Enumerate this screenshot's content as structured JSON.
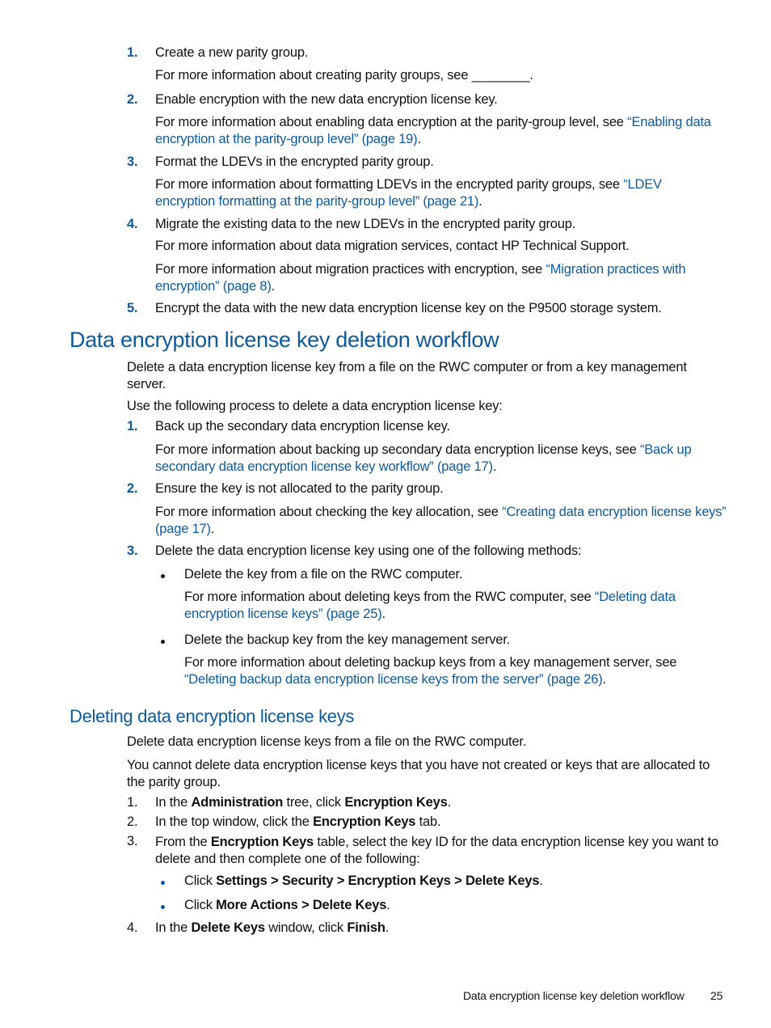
{
  "colors": {
    "accent": "#0d5a9a",
    "text": "#111111"
  },
  "top_list": [
    {
      "num": "1.",
      "text": "Create a new parity group.",
      "info": [
        {
          "pre": "For more information about creating parity groups, see ________.",
          "link": "",
          "post": ""
        }
      ]
    },
    {
      "num": "2.",
      "text": "Enable encryption with the new data encryption license key.",
      "info": [
        {
          "pre": "For more information about enabling data encryption at the parity-group level, see ",
          "link": "“Enabling data encryption at the parity-group level” (page 19)",
          "post": "."
        }
      ]
    },
    {
      "num": "3.",
      "text": "Format the LDEVs in the encrypted parity group.",
      "info": [
        {
          "pre": "For more information about formatting LDEVs in the encrypted parity groups, see ",
          "link": "“LDEV encryption formatting at the parity-group level” (page 21)",
          "post": "."
        }
      ]
    },
    {
      "num": "4.",
      "text": "Migrate the existing data to the new LDEVs in the encrypted parity group.",
      "info": [
        {
          "pre": "For more information about data migration services, contact HP Technical Support.",
          "link": "",
          "post": ""
        },
        {
          "pre": "For more information about migration practices with encryption, see ",
          "link": "“Migration practices with encryption” (page 8)",
          "post": "."
        }
      ]
    },
    {
      "num": "5.",
      "text": "Encrypt the data with the new data encryption license key on the P9500 storage system.",
      "info": []
    }
  ],
  "section1": {
    "heading": "Data encryption license key deletion workflow",
    "intro": "Delete a data encryption license key from a file on the RWC computer or from a key management server.",
    "lead": "Use the following process to delete a data encryption license key:",
    "steps": [
      {
        "num": "1.",
        "text": "Back up the secondary data encryption license key.",
        "pre": "For more information about backing up secondary data encryption license keys, see ",
        "link": "“Back up secondary data encryption license key workflow” (page 17)",
        "post": "."
      },
      {
        "num": "2.",
        "text": "Ensure the key is not allocated to the parity group.",
        "pre": "For more information about checking the key allocation, see ",
        "link": "“Creating data encryption license keys” (page 17)",
        "post": "."
      },
      {
        "num": "3.",
        "text": "Delete the data encryption license key using one of the following methods:",
        "bullets": [
          {
            "text": "Delete the key from a file on the RWC computer.",
            "pre": "For more information about deleting keys from the RWC computer, see ",
            "link": "“Deleting data encryption license keys” (page 25)",
            "post": "."
          },
          {
            "text": "Delete the backup key from the key management server.",
            "pre": "For more information about deleting backup keys from a key management server, see ",
            "link": "“Deleting backup data encryption license keys from the server” (page 26)",
            "post": "."
          }
        ]
      }
    ]
  },
  "section2": {
    "heading": "Deleting data encryption license keys",
    "intro": "Delete data encryption license keys from a file on the RWC computer.",
    "note": "You cannot delete data encryption license keys that you have not created or keys that are allocated to the parity group.",
    "steps": [
      {
        "num": "1.",
        "parts": [
          "In the ",
          "Administration",
          " tree, click ",
          "Encryption Keys",
          "."
        ]
      },
      {
        "num": "2.",
        "parts": [
          "In the top window, click the ",
          "Encryption Keys",
          " tab."
        ]
      },
      {
        "num": "3.",
        "parts": [
          "From the ",
          "Encryption Keys",
          " table, select the key ID for the data encryption license key you want to delete and then complete one of the following:"
        ],
        "bullets": [
          {
            "parts": [
              "Click ",
              "Settings > Security > Encryption Keys > Delete Keys",
              "."
            ]
          },
          {
            "parts": [
              "Click ",
              "More Actions > Delete Keys",
              "."
            ]
          }
        ]
      },
      {
        "num": "4.",
        "parts": [
          "In the ",
          "Delete Keys",
          " window, click ",
          "Finish",
          "."
        ]
      }
    ]
  },
  "footer": {
    "title": "Data encryption license key deletion workflow",
    "page": "25"
  }
}
